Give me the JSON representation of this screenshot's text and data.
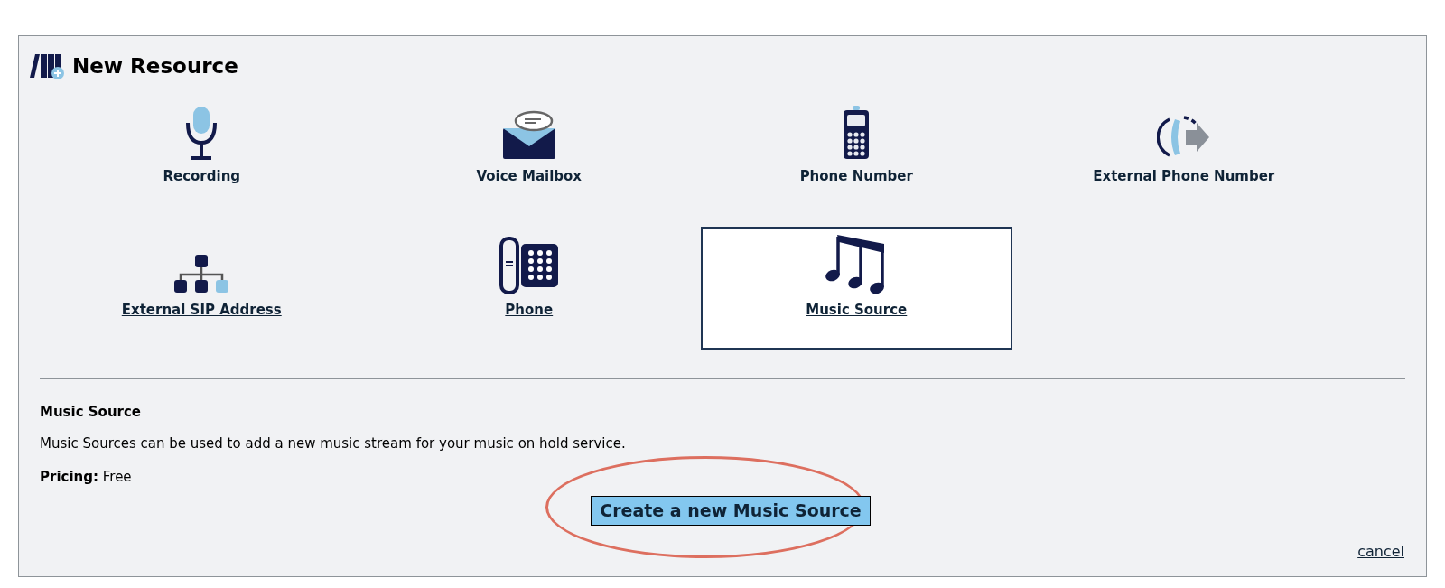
{
  "dialog": {
    "title": "New Resource"
  },
  "resources": [
    {
      "kind": "recording",
      "label": "Recording",
      "selected": false
    },
    {
      "kind": "mailbox",
      "label": "Voice Mailbox",
      "selected": false
    },
    {
      "kind": "mobile",
      "label": "Phone Number",
      "selected": false
    },
    {
      "kind": "external",
      "label": "External Phone Number",
      "selected": false
    },
    {
      "kind": "sip",
      "label": "External SIP Address",
      "selected": false
    },
    {
      "kind": "deskphone",
      "label": "Phone",
      "selected": false
    },
    {
      "kind": "music",
      "label": "Music Source",
      "selected": true
    }
  ],
  "details": {
    "heading": "Music Source",
    "description": "Music Sources can be used to add a new music stream for your music on hold service.",
    "pricing_label": "Pricing:",
    "pricing_value": "Free",
    "create_button": "Create a new Music Source",
    "highlighted": true
  },
  "cancel": "cancel"
}
